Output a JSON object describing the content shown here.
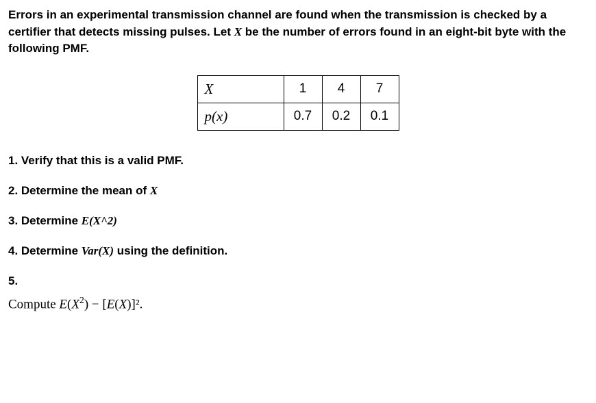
{
  "problem": {
    "text_before_var": "Errors in an experimental transmission channel are found when the transmission is checked by a certifier that detects missing pulses. Let ",
    "var": "X",
    "text_after_var": " be the number of errors found in an eight-bit byte with the following PMF."
  },
  "table": {
    "row1_label": "X",
    "row2_label": "p(x)",
    "x_vals": [
      "1",
      "4",
      "7"
    ],
    "p_vals": [
      "0.7",
      "0.2",
      "0.1"
    ]
  },
  "questions": {
    "q1": "1. Verify that this is a valid PMF.",
    "q2_prefix": "2. Determine the mean of ",
    "q2_var": "X",
    "q3_prefix": "3. Determine ",
    "q3_italic": "E(X^2)",
    "q4_prefix": "4. Determine  ",
    "q4_italic": "Var(X)",
    "q4_suffix": " using the definition.",
    "q5": "5.",
    "q5_sub_prefix": "Compute ",
    "q5_formula_e": "E",
    "q5_formula_x": "X",
    "q5_formula_minus": " − [",
    "q5_formula_close": ")]²."
  },
  "chart_data": {
    "type": "table",
    "title": "PMF of X (number of errors in an eight-bit byte)",
    "columns": [
      "X",
      "p(x)"
    ],
    "rows": [
      {
        "X": 1,
        "p(x)": 0.7
      },
      {
        "X": 4,
        "p(x)": 0.2
      },
      {
        "X": 7,
        "p(x)": 0.1
      }
    ]
  }
}
